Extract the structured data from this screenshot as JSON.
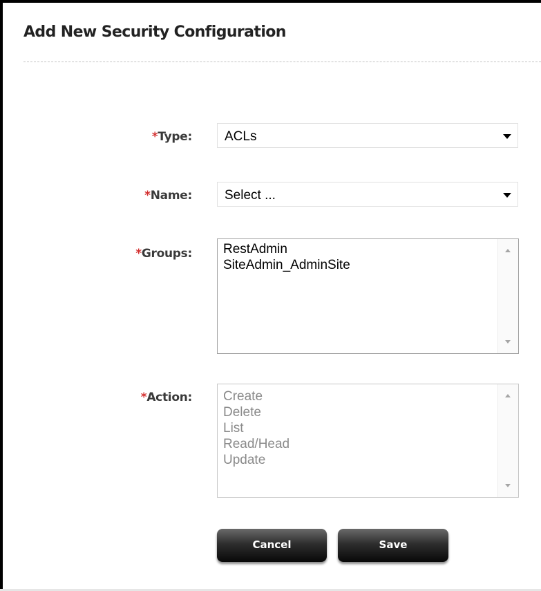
{
  "dialog": {
    "title": "Add New Security Configuration"
  },
  "form": {
    "type": {
      "required_mark": "*",
      "label": "Type:",
      "value": "ACLs"
    },
    "name": {
      "required_mark": "*",
      "label": "Name:",
      "value": "Select ..."
    },
    "groups": {
      "required_mark": "*",
      "label": "Groups:",
      "options": [
        "RestAdmin",
        "SiteAdmin_AdminSite"
      ]
    },
    "action": {
      "required_mark": "*",
      "label": "Action:",
      "options": [
        "Create",
        "Delete",
        "List",
        "Read/Head",
        "Update"
      ],
      "disabled": true
    }
  },
  "buttons": {
    "cancel": "Cancel",
    "save": "Save"
  },
  "colors": {
    "required": "#d32f2f",
    "label": "#3a3a3a",
    "disabled_text": "#8a8a8a",
    "button_dark": "#080808"
  },
  "icons": {
    "dropdown": "caret-down-icon",
    "scroll_up": "scroll-up-arrow-icon",
    "scroll_down": "scroll-down-arrow-icon"
  }
}
